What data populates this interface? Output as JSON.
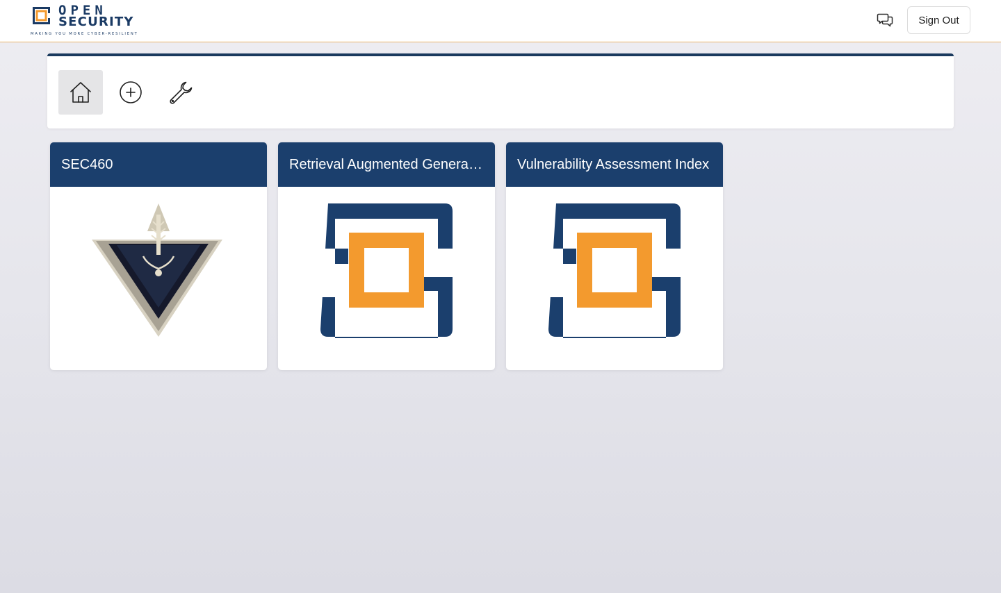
{
  "header": {
    "logo": {
      "word1": "OPEN",
      "word2": "SECURITY",
      "tagline": "MAKING YOU MORE CYBER-RESILIENT"
    },
    "chat_icon": "chat-bubbles-icon",
    "signout_label": "Sign Out"
  },
  "toolbar": {
    "buttons": [
      {
        "name": "home",
        "icon": "home-icon",
        "active": true
      },
      {
        "name": "add",
        "icon": "plus-circle-icon",
        "active": false
      },
      {
        "name": "settings",
        "icon": "wrench-icon",
        "active": false
      }
    ]
  },
  "cards": [
    {
      "title": "SEC460",
      "image": "arrowhead-emblem"
    },
    {
      "title": "Retrieval Augmented Generation",
      "image": "open-security-logo"
    },
    {
      "title": "Vulnerability Assessment Index",
      "image": "open-security-logo"
    }
  ],
  "colors": {
    "brand_navy": "#1b3f6d",
    "brand_orange": "#f39a2e",
    "header_border": "#e9b36a"
  }
}
